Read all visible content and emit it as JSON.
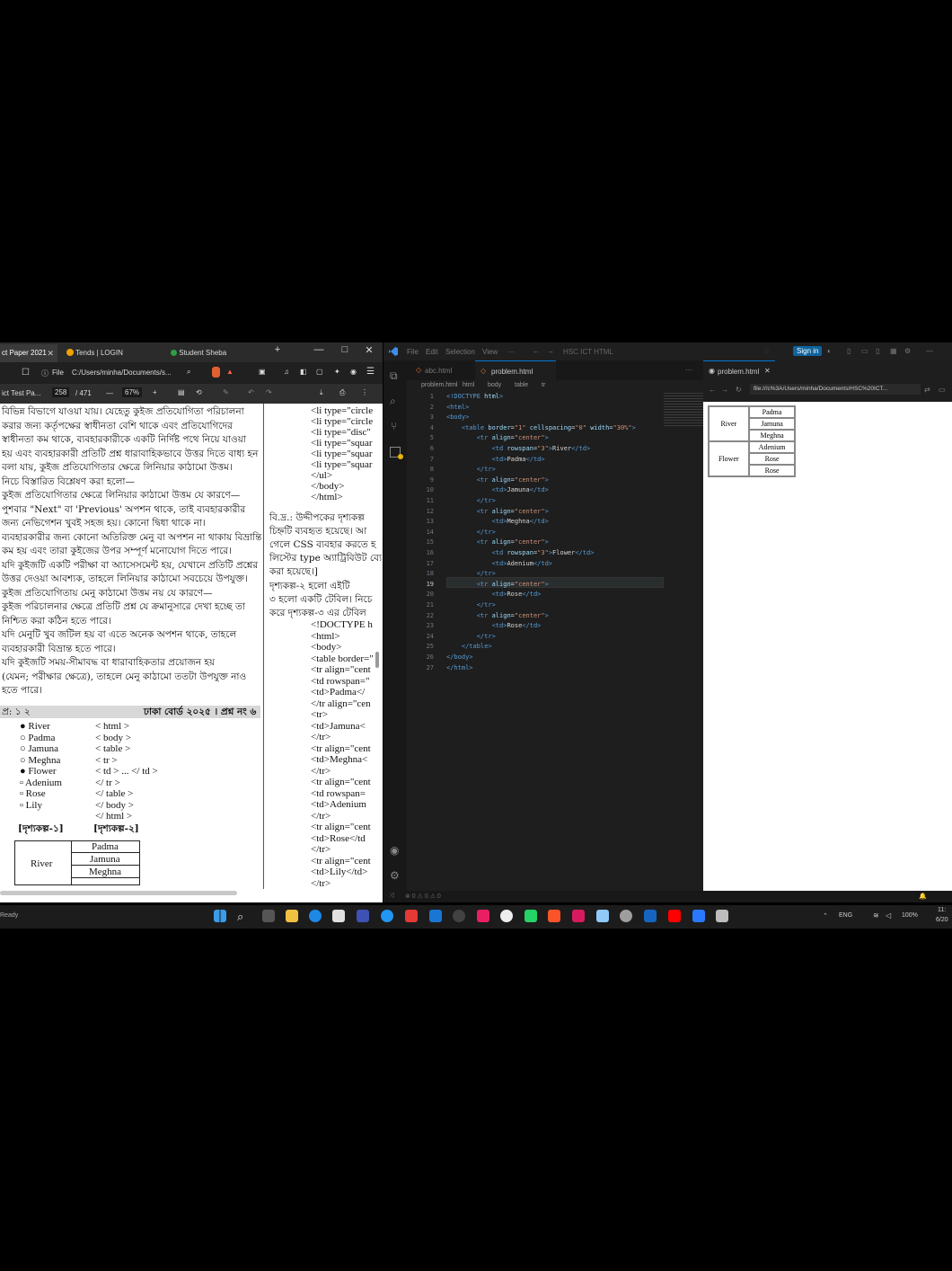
{
  "browser": {
    "tabs": [
      {
        "label": "ct Paper 2021",
        "active": true
      },
      {
        "label": "Tends | LOGIN"
      },
      {
        "label": "Student Sheba"
      }
    ],
    "new_tab": "+",
    "window_controls": {
      "minimize": "—",
      "maximize": "□",
      "close": "✕"
    },
    "address": {
      "file_label": "File",
      "url": "C:/Users/minha/Documents/s..."
    },
    "pdf_toolbar": {
      "title": "ict Test Pa...",
      "page": "258",
      "total": "/ 471",
      "zoom": "67%",
      "minus": "—",
      "plus": "+"
    }
  },
  "pdf": {
    "left_paragraph": [
      "বিভিন্ন বিভাগে যাওয়া যায়। যেহেতু কুইজ প্রতিযোগিতা পরিচালনা",
      "করার জন্য কর্তৃপক্ষের স্বাধীনতা বেশি থাকে এবং প্রতিযোগিদের",
      "স্বাধীনতা কম থাকে, ব্যবহারকারীকে একটি নির্দিষ্ট পথে নিয়ে যাওয়া",
      "হয় এবং ব্যবহারকারী প্রতিটি প্রশ্ন ধারাবাহিকভাবে উত্তর দিতে বাধ্য হন",
      "বলা যায়, কুইজ প্রতিযোগিতার ক্ষেত্রে লিনিয়ার কাঠামো উত্তম।",
      "নিচে বিস্তারিত বিশ্লেষণ করা হলো—",
      "কুইজ প্রতিযোগিতার ক্ষেত্রে লিনিয়ার কাঠামো উত্তম যে কারণে—",
      "পুশবার \"Next\" বা 'Previous' অপশন থাকে, তাই ব্যবহারকারীর",
      "জন্য নেভিগেশন খুবই সহজ হয়। কোনো দ্বিধা থাকে না।",
      "ব্যবহারকারীর জন্য কোনো অতিরিক্ত মেনু বা অপশন না থাকায় বিভ্রান্তি",
      "কম হয় এবং তারা কুইজের উপর সম্পূর্ণ মনোযোগ দিতে পারে।",
      "যদি কুইজটি একটি পরীক্ষা বা অ্যাসেসমেন্ট হয়, যেখানে প্রতিটি প্রশ্নের",
      "উত্তর দেওয়া আবশ্যক, তাহলে লিনিয়ার কাঠামো সবচেয়ে উপযুক্ত।",
      "কুইজ প্রতিযোগিতায় মেনু কাঠামো উত্তম নয় যে কারণে—",
      "কুইজ পরিচালনার ক্ষেত্রে প্রতিটি প্রশ্ন যে ক্রমানুসারে দেখা হচ্ছে তা",
      "নিশ্চিত করা কঠিন হতে পারে।",
      "যদি মেনুটি খুব জটিল হয় বা এতে অনেক অপশন থাকে, তাহলে",
      "ব্যবহারকারী বিভ্রান্ত হতে পারে।",
      "যদি কুইজটি সময়-সীমাবদ্ধ বা ধারাবাহিকতার প্রয়োজন হয়",
      "(যেমন; পরীক্ষার ক্ষেত্রে), তাহলে মেনু কাঠামো ততটা উপযুক্ত নাও",
      "হতে পারে।"
    ],
    "question_label": "প্র: ১ ২",
    "board_label": "ঢাকা বোর্ড ২০২৫ । প্রশ্ন নং ৬",
    "list_items": [
      "● River",
      "○ Padma",
      "○ Jamuna",
      "○ Meghna",
      "● Flower",
      "▫ Adenium",
      "▫ Rose",
      "▫ Lily"
    ],
    "html_lines": [
      "< html >",
      "< body >",
      "< table >",
      "< tr >",
      "< td > ... </ td >",
      "</ tr >",
      "</ table >",
      "</ body >",
      "</ html >"
    ],
    "fig1": "[দৃশ্যকল্প-১]",
    "fig2": "[দৃশ্যকল্প-২]",
    "table_river": "River",
    "table_cells": [
      "Padma",
      "Jamuna",
      "Meghna"
    ],
    "right_col_top": [
      "<li type=\"circle",
      "<li type=\"circle",
      "<li type=\"disc\"",
      "<li type=\"squar",
      "<li type=\"squar",
      "<li type=\"squar",
      "</ul>",
      "</body>",
      "</html>"
    ],
    "note": [
      "বি.দ্র.: উদ্দীপকের দৃশ্যকল্প",
      "চিহ্নটি ব্যবহৃত হয়েছে। আ",
      "গেলে CSS ব্যবহার করতে হ",
      "লিস্টের type অ্যাট্রিবিউট ব্যে",
      "করা হয়েছে।]"
    ],
    "q2": [
      "দৃশ্যকল্প-২ হলো এইটি",
      "৩ হলো একটি টেবিল। নিচে",
      "করে দৃশ্যকল্প-৩ এর টেবিল"
    ],
    "right_code": [
      "<!DOCTYPE h",
      "<html>",
      "<body>",
      "<table border=\"",
      "<tr align=\"cent",
      "<td rowspan=\"",
      "<td>Padma</",
      "</tr align=\"cen",
      "<tr>",
      "<td>Jamuna<",
      "</tr>",
      "<tr align=\"cent",
      "<td>Meghna<",
      "</tr>",
      "<tr align=\"cent",
      "<td rowspan=",
      "<td>Adenium",
      "</tr>",
      "<tr align=\"cent",
      "<td>Rose</td",
      "</tr>",
      "<tr align=\"cent",
      "<td>Lily</td>",
      "</tr>"
    ]
  },
  "vscode": {
    "menu": [
      "File",
      "Edit",
      "Selection",
      "View",
      "···"
    ],
    "search": "HSC ICT HTML",
    "sign_in": "Sign in",
    "tabs": [
      {
        "label": "abc.html"
      },
      {
        "label": "problem.html",
        "active": true
      }
    ],
    "breadcrumb": [
      "problem.html",
      "html",
      "body",
      "table",
      "tr"
    ],
    "lines": [
      [
        [
          "tg",
          "<!DOCTYPE"
        ],
        [
          "at",
          " html"
        ],
        [
          "tg",
          ">"
        ]
      ],
      [
        [
          "tg",
          "<html>"
        ]
      ],
      [
        [
          "tg",
          "<body>"
        ]
      ],
      [
        [
          "tx",
          "    "
        ],
        [
          "tg",
          "<table"
        ],
        [
          "at",
          " border"
        ],
        [
          "tx",
          "="
        ],
        [
          "st",
          "\"1\""
        ],
        [
          "at",
          " cellspacing"
        ],
        [
          "tx",
          "="
        ],
        [
          "st",
          "\"0\""
        ],
        [
          "at",
          " width"
        ],
        [
          "tx",
          "="
        ],
        [
          "st",
          "\"30%\""
        ],
        [
          "tg",
          ">"
        ]
      ],
      [
        [
          "tx",
          "        "
        ],
        [
          "tg",
          "<tr"
        ],
        [
          "at",
          " align"
        ],
        [
          "tx",
          "="
        ],
        [
          "st",
          "\"center\""
        ],
        [
          "tg",
          ">"
        ]
      ],
      [
        [
          "tx",
          "            "
        ],
        [
          "tg",
          "<td"
        ],
        [
          "at",
          " rowspan"
        ],
        [
          "tx",
          "="
        ],
        [
          "st",
          "\"3\""
        ],
        [
          "tg",
          ">"
        ],
        [
          "tx",
          "River"
        ],
        [
          "tg",
          "</td>"
        ]
      ],
      [
        [
          "tx",
          "            "
        ],
        [
          "tg",
          "<td>"
        ],
        [
          "tx",
          "Padma"
        ],
        [
          "tg",
          "</td>"
        ]
      ],
      [
        [
          "tx",
          "        "
        ],
        [
          "tg",
          "</tr>"
        ]
      ],
      [
        [
          "tx",
          "        "
        ],
        [
          "tg",
          "<tr"
        ],
        [
          "at",
          " align"
        ],
        [
          "tx",
          "="
        ],
        [
          "st",
          "\"center\""
        ],
        [
          "tg",
          ">"
        ]
      ],
      [
        [
          "tx",
          "            "
        ],
        [
          "tg",
          "<td>"
        ],
        [
          "tx",
          "Jamuna"
        ],
        [
          "tg",
          "</td>"
        ]
      ],
      [
        [
          "tx",
          "        "
        ],
        [
          "tg",
          "</tr>"
        ]
      ],
      [
        [
          "tx",
          "        "
        ],
        [
          "tg",
          "<tr"
        ],
        [
          "at",
          " align"
        ],
        [
          "tx",
          "="
        ],
        [
          "st",
          "\"center\""
        ],
        [
          "tg",
          ">"
        ]
      ],
      [
        [
          "tx",
          "            "
        ],
        [
          "tg",
          "<td>"
        ],
        [
          "tx",
          "Meghna"
        ],
        [
          "tg",
          "</td>"
        ]
      ],
      [
        [
          "tx",
          "        "
        ],
        [
          "tg",
          "</tr>"
        ]
      ],
      [
        [
          "tx",
          "        "
        ],
        [
          "tg",
          "<tr"
        ],
        [
          "at",
          " align"
        ],
        [
          "tx",
          "="
        ],
        [
          "st",
          "\"center\""
        ],
        [
          "tg",
          ">"
        ]
      ],
      [
        [
          "tx",
          "            "
        ],
        [
          "tg",
          "<td"
        ],
        [
          "at",
          " rowspan"
        ],
        [
          "tx",
          "="
        ],
        [
          "st",
          "\"3\""
        ],
        [
          "tg",
          ">"
        ],
        [
          "tx",
          "Flower"
        ],
        [
          "tg",
          "</td>"
        ]
      ],
      [
        [
          "tx",
          "            "
        ],
        [
          "tg",
          "<td>"
        ],
        [
          "tx",
          "Adenium"
        ],
        [
          "tg",
          "</td>"
        ]
      ],
      [
        [
          "tx",
          "        "
        ],
        [
          "tg",
          "</tr>"
        ]
      ],
      [
        [
          "tx",
          "        "
        ],
        [
          "tg",
          "<tr"
        ],
        [
          "at",
          " align"
        ],
        [
          "tx",
          "="
        ],
        [
          "st",
          "\"center\""
        ],
        [
          "tg",
          ">"
        ]
      ],
      [
        [
          "tx",
          "            "
        ],
        [
          "tg",
          "<td>"
        ],
        [
          "tx",
          "Rose"
        ],
        [
          "tg",
          "</td>"
        ]
      ],
      [
        [
          "tx",
          "        "
        ],
        [
          "tg",
          "</tr>"
        ]
      ],
      [
        [
          "tx",
          "        "
        ],
        [
          "tg",
          "<tr"
        ],
        [
          "at",
          " align"
        ],
        [
          "tx",
          "="
        ],
        [
          "st",
          "\"center\""
        ],
        [
          "tg",
          ">"
        ]
      ],
      [
        [
          "tx",
          "            "
        ],
        [
          "tg",
          "<td>"
        ],
        [
          "tx",
          "Rose"
        ],
        [
          "tg",
          "</td>"
        ]
      ],
      [
        [
          "tx",
          "        "
        ],
        [
          "tg",
          "</tr>"
        ]
      ],
      [
        [
          "tx",
          "    "
        ],
        [
          "tg",
          "</table>"
        ]
      ],
      [
        [
          "tg",
          "</body>"
        ]
      ],
      [
        [
          "tg",
          "</html>"
        ]
      ]
    ],
    "active_line": 19,
    "preview": {
      "tab": "problem.html",
      "url": "file:///c%3A/Users/minha/Documents/HSC%20ICT...",
      "table": {
        "group1": "River",
        "group1_items": [
          "Padma",
          "Jamuna",
          "Meghna"
        ],
        "group2": "Flower",
        "group2_items": [
          "Adenium",
          "Rose",
          "Rose"
        ]
      }
    },
    "status": "⊗ 0 ⚠ 0 ⚠ 0"
  },
  "taskbar": {
    "status_left": "Ready",
    "tray": {
      "lang": "ENG",
      "battery": "100%",
      "time": "11:",
      "date": "6/20"
    }
  }
}
